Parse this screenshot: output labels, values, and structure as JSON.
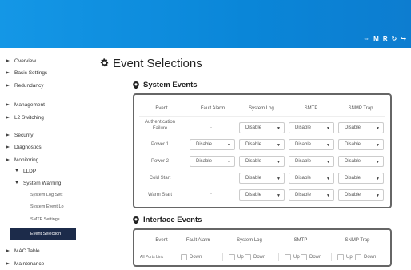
{
  "header": {
    "icons": [
      "⇔",
      "M",
      "R",
      "↻",
      "↪"
    ]
  },
  "sidebar": {
    "items": [
      {
        "label": "Overview"
      },
      {
        "label": "Basic Settings"
      },
      {
        "label": "Redundancy"
      },
      {
        "label": "Management"
      },
      {
        "label": "L2 Switching"
      },
      {
        "label": "Security"
      },
      {
        "label": "Diagnostics"
      },
      {
        "label": "Monitoring"
      },
      {
        "label": "LLDP"
      },
      {
        "label": "System Warning"
      },
      {
        "label": "System Log Sett"
      },
      {
        "label": "System Event Lo"
      },
      {
        "label": "SMTP Settings"
      },
      {
        "label": "Event Selection"
      },
      {
        "label": "MAC Table"
      },
      {
        "label": "Maintenance"
      }
    ]
  },
  "page": {
    "title": "Event Selections"
  },
  "system_events": {
    "title": "System Events",
    "headers": [
      "Event",
      "Fault Alarm",
      "System Log",
      "SMTP",
      "SNMP Trap"
    ],
    "rows": [
      {
        "event": "Authentication Failure",
        "fault": "-",
        "syslog": "Disable",
        "smtp": "Disable",
        "snmp": "Disable"
      },
      {
        "event": "Power 1",
        "fault": "Disable",
        "syslog": "Disable",
        "smtp": "Disable",
        "snmp": "Disable"
      },
      {
        "event": "Power 2",
        "fault": "Disable",
        "syslog": "Disable",
        "smtp": "Disable",
        "snmp": "Disable"
      },
      {
        "event": "Cold Start",
        "fault": "-",
        "syslog": "Disable",
        "smtp": "Disable",
        "snmp": "Disable"
      },
      {
        "event": "Warm Start",
        "fault": "-",
        "syslog": "Disable",
        "smtp": "Disable",
        "snmp": "Disable"
      }
    ]
  },
  "interface_events": {
    "title": "Interface Events",
    "headers": [
      "Event",
      "Fault Alarm",
      "System Log",
      "SMTP",
      "SNMP Trap"
    ],
    "row": {
      "event": "All Ports Link",
      "fault": "Down",
      "syslog_up": "Up",
      "syslog_down": "Down",
      "smtp_up": "Up",
      "smtp_down": "Down",
      "snmp_up": "Up",
      "snmp_down": "Down"
    }
  }
}
